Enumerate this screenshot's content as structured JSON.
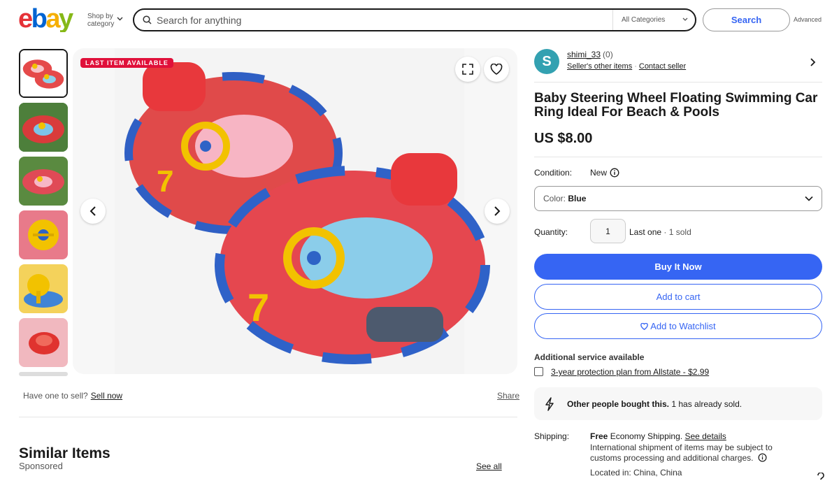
{
  "header": {
    "logo_text": "ebay",
    "shop_by": "Shop by",
    "shop_by_category": "category",
    "search_placeholder": "Search for anything",
    "category_select": "All Categories",
    "search_button": "Search",
    "advanced": "Advanced"
  },
  "gallery": {
    "badge": "LAST ITEM AVAILABLE",
    "thumbnails": [
      "thumb-1",
      "thumb-2",
      "thumb-3",
      "thumb-4",
      "thumb-5",
      "thumb-6"
    ]
  },
  "left_footer": {
    "have_one": "Have one to sell?",
    "sell_now": "Sell now",
    "share": "Share",
    "similar_items": "Similar Items",
    "sponsored": "Sponsored",
    "see_all": "See all"
  },
  "seller": {
    "initial": "S",
    "name": "shimi_33",
    "feedback": "(0)",
    "other_items": "Seller's other items",
    "contact": "Contact seller"
  },
  "item": {
    "title": "Baby Steering Wheel Floating Swimming Car Ring Ideal For Beach & Pools",
    "price": "US $8.00",
    "condition_label": "Condition:",
    "condition": "New",
    "color_label": "Color:",
    "color_value": "Blue",
    "quantity_label": "Quantity:",
    "quantity": "1",
    "last_one": "Last one",
    "sold": "1 sold",
    "buy_now": "Buy It Now",
    "add_cart": "Add to cart",
    "add_watchlist": "Add to Watchlist",
    "additional_service": "Additional service available",
    "protection_plan": "3-year protection plan from Allstate - $2.99",
    "social_bold": "Other people bought this.",
    "social_rest": "1 has already sold.",
    "shipping_label": "Shipping:",
    "shipping_free": "Free",
    "shipping_type": "Economy Shipping",
    "see_details": "See details",
    "intl_text": "International shipment of items may be subject to customs processing and additional charges.",
    "located_in": "Located in: China, China"
  },
  "colors": {
    "accent": "#3665f3",
    "badge": "#e0103a",
    "avatar": "#33a1b1"
  }
}
